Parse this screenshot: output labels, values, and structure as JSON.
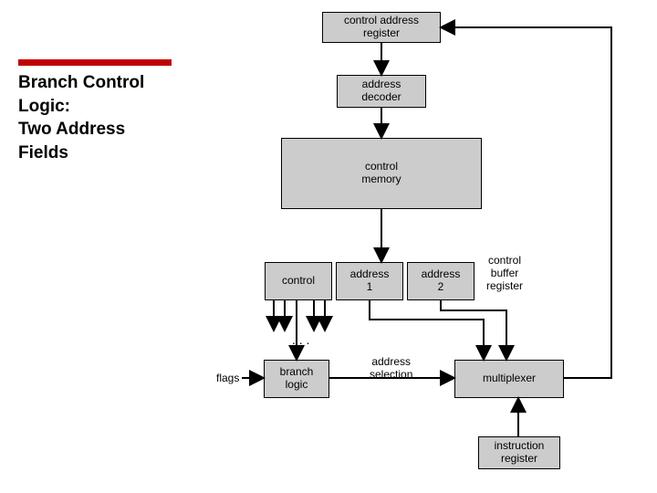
{
  "title_lines": {
    "l1": "Branch Control",
    "l2": "Logic:",
    "l3": "Two Address",
    "l4": "Fields"
  },
  "boxes": {
    "car": "control address\nregister",
    "decoder": "address\ndecoder",
    "memory": "control\nmemory",
    "control": "control",
    "addr1": "address\n1",
    "addr2": "address\n2",
    "branch_logic": "branch\nlogic",
    "multiplexer": "multiplexer",
    "ir": "instruction\nregister"
  },
  "labels": {
    "cbr": "control\nbuffer\nregister",
    "flags": "flags",
    "addr_sel": "address\nselection",
    "dots": ". . ."
  }
}
